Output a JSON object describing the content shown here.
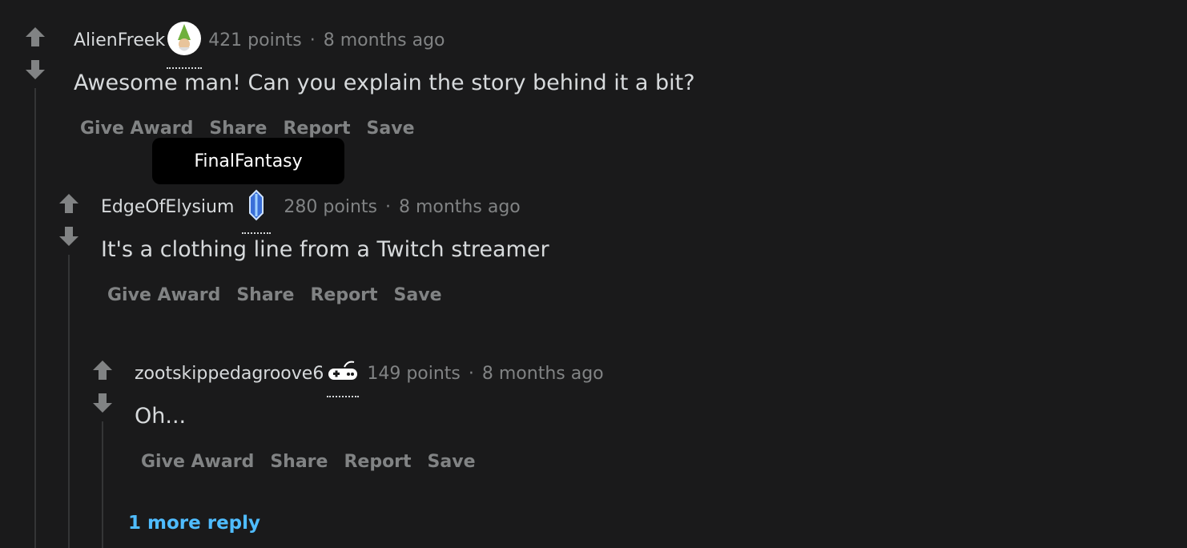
{
  "comments": [
    {
      "author": "AlienFreek",
      "flair_icon": "gnome-avatar-icon",
      "points": "421 points",
      "time": "8 months ago",
      "body": "Awesome man! Can you explain the story behind it a bit?"
    },
    {
      "author": "EdgeOfElysium",
      "flair_icon": "crystal-icon",
      "points": "280 points",
      "time": "8 months ago",
      "body": "It's a clothing line from a Twitch streamer"
    },
    {
      "author": "zootskippedagroove6",
      "flair_icon": "game-controller-icon",
      "points": "149 points",
      "time": "8 months ago",
      "body": "Oh..."
    }
  ],
  "actions": {
    "give_award": "Give Award",
    "share": "Share",
    "report": "Report",
    "save": "Save"
  },
  "separator": "·",
  "tooltip": "FinalFantasy",
  "more_reply": "1 more reply",
  "colors": {
    "background": "#1a1a1b",
    "text": "#d7dadc",
    "muted": "#818384",
    "link": "#4fbcff"
  }
}
